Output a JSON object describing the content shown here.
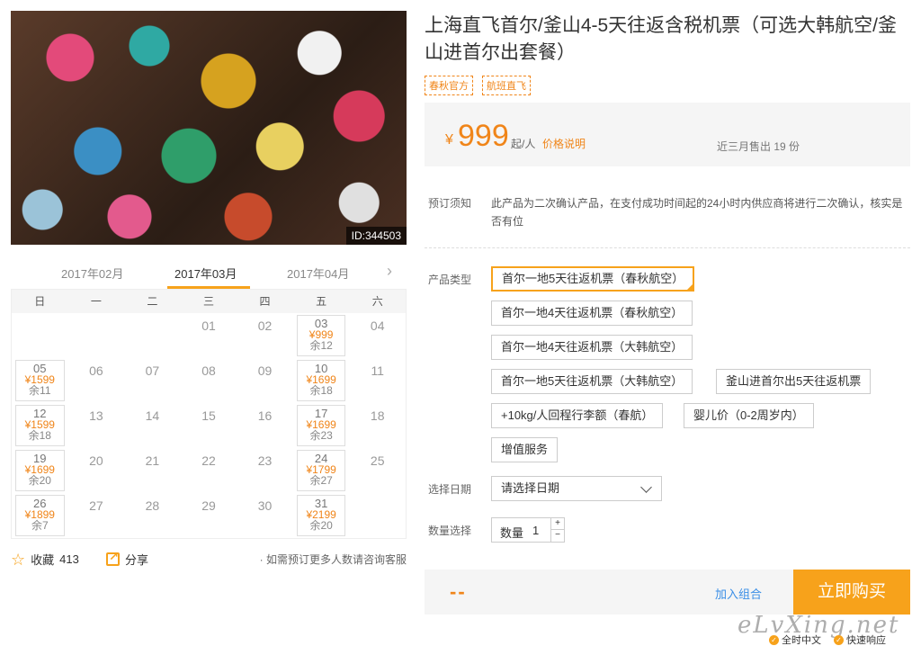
{
  "hero": {
    "image_id": "ID:344503"
  },
  "calendar": {
    "months": [
      "2017年02月",
      "2017年03月",
      "2017年04月"
    ],
    "active_month": "2017年03月",
    "weekdays": [
      "日",
      "一",
      "二",
      "三",
      "四",
      "五",
      "六"
    ],
    "days": [
      {
        "d": ""
      },
      {
        "d": ""
      },
      {
        "d": ""
      },
      {
        "d": "01"
      },
      {
        "d": "02"
      },
      {
        "d": "03",
        "price": "¥999",
        "stock": "余12"
      },
      {
        "d": "04"
      },
      {
        "d": "05",
        "price": "¥1599",
        "stock": "余11"
      },
      {
        "d": "06"
      },
      {
        "d": "07"
      },
      {
        "d": "08"
      },
      {
        "d": "09"
      },
      {
        "d": "10",
        "price": "¥1699",
        "stock": "余18"
      },
      {
        "d": "11"
      },
      {
        "d": "12",
        "price": "¥1599",
        "stock": "余18"
      },
      {
        "d": "13"
      },
      {
        "d": "14"
      },
      {
        "d": "15"
      },
      {
        "d": "16"
      },
      {
        "d": "17",
        "price": "¥1699",
        "stock": "余23"
      },
      {
        "d": "18"
      },
      {
        "d": "19",
        "price": "¥1699",
        "stock": "余20"
      },
      {
        "d": "20"
      },
      {
        "d": "21"
      },
      {
        "d": "22"
      },
      {
        "d": "23"
      },
      {
        "d": "24",
        "price": "¥1799",
        "stock": "余27"
      },
      {
        "d": "25"
      },
      {
        "d": "26",
        "price": "¥1899",
        "stock": "余7"
      },
      {
        "d": "27"
      },
      {
        "d": "28"
      },
      {
        "d": "29"
      },
      {
        "d": "30"
      },
      {
        "d": "31",
        "price": "¥2199",
        "stock": "余20"
      },
      {
        "d": ""
      }
    ]
  },
  "actions": {
    "fav_label": "收藏",
    "fav_count": "413",
    "share_label": "分享",
    "note": "· 如需预订更多人数请咨询客服"
  },
  "product": {
    "title": "上海直飞首尔/釜山4-5天往返含税机票（可选大韩航空/釜山进首尔出套餐）",
    "tags": [
      "春秋官方",
      "航班直飞"
    ],
    "currency": "¥",
    "price": "999",
    "price_unit": "起/人",
    "price_note_link": "价格说明",
    "sold": "近三月售出 19 份"
  },
  "booking": {
    "notice_label": "预订须知",
    "notice_text": "此产品为二次确认产品，在支付成功时间起的24小时内供应商将进行二次确认，核实是否有位",
    "type_label": "产品类型",
    "options": [
      "首尔一地5天往返机票（春秋航空）",
      "首尔一地4天往返机票（春秋航空）",
      "首尔一地4天往返机票（大韩航空）",
      "首尔一地5天往返机票（大韩航空）",
      "釜山进首尔出5天往返机票",
      "+10kg/人回程行李额（春航）",
      "婴儿价（0-2周岁内）",
      "增值服务"
    ],
    "date_label": "选择日期",
    "date_placeholder": "请选择日期",
    "qty_section_label": "数量选择",
    "qty_label": "数量",
    "qty_value": "1",
    "plus": "+",
    "minus": "−"
  },
  "buybar": {
    "total": "--",
    "combo_label": "加入组合",
    "buy_label": "立即购买"
  },
  "footer": {
    "watermark": "eLvXing.net",
    "badge1": "全时中文",
    "badge2": "快速响应"
  },
  "colors": {
    "accent": "#f7a21b",
    "price": "#f08519",
    "link": "#3a8ee6"
  }
}
